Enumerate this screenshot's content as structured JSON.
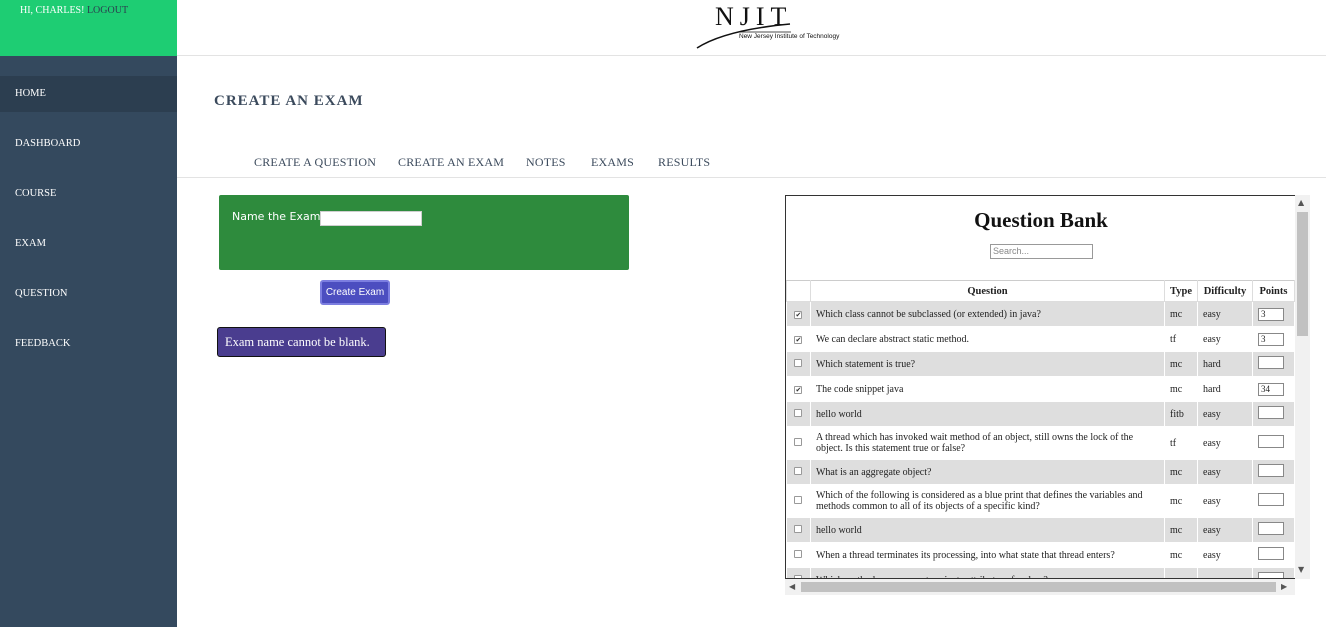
{
  "user": {
    "greeting": "HI, CHARLES!",
    "logout_label": "LOGOUT"
  },
  "sidebar": {
    "items": [
      {
        "label": "HOME",
        "active": true
      },
      {
        "label": "DASHBOARD"
      },
      {
        "label": "COURSE"
      },
      {
        "label": "EXAM"
      },
      {
        "label": "QUESTION"
      },
      {
        "label": "FEEDBACK"
      }
    ]
  },
  "header": {
    "logo_text": "NJIT",
    "logo_subtitle": "New Jersey Institute of Technology"
  },
  "page": {
    "title": "CREATE AN EXAM"
  },
  "subnav": {
    "items": [
      "CREATE A QUESTION",
      "CREATE AN EXAM",
      "NOTES",
      "EXAMS",
      "RESULTS"
    ]
  },
  "exam_form": {
    "name_label": "Name the Exam:",
    "name_value": "",
    "create_button": "Create Exam",
    "error_message": "Exam name cannot be blank."
  },
  "question_bank": {
    "title": "Question Bank",
    "search_placeholder": "Search...",
    "columns": [
      "",
      "Question",
      "Type",
      "Difficulty",
      "Points"
    ],
    "rows": [
      {
        "checked": true,
        "question": "Which class cannot be subclassed (or extended) in java?",
        "type": "mc",
        "difficulty": "easy",
        "points": "3"
      },
      {
        "checked": true,
        "question": "We can declare abstract static method.",
        "type": "tf",
        "difficulty": "easy",
        "points": "3"
      },
      {
        "checked": false,
        "question": "Which statement is true?",
        "type": "mc",
        "difficulty": "hard",
        "points": ""
      },
      {
        "checked": true,
        "question": "The code snippet java",
        "type": "mc",
        "difficulty": "hard",
        "points": "34"
      },
      {
        "checked": false,
        "question": "hello world",
        "type": "fitb",
        "difficulty": "easy",
        "points": ""
      },
      {
        "checked": false,
        "question": "A thread which has invoked wait method of an object, still owns the lock of the object. Is this statement true or false?",
        "type": "tf",
        "difficulty": "easy",
        "points": ""
      },
      {
        "checked": false,
        "question": "What is an aggregate object?",
        "type": "mc",
        "difficulty": "easy",
        "points": ""
      },
      {
        "checked": false,
        "question": "Which of the following is considered as a blue print that defines the variables and methods common to all of its objects of a specific kind?",
        "type": "mc",
        "difficulty": "easy",
        "points": ""
      },
      {
        "checked": false,
        "question": "hello world",
        "type": "mc",
        "difficulty": "easy",
        "points": ""
      },
      {
        "checked": false,
        "question": "When a thread terminates its processing, into what state that thread enters?",
        "type": "mc",
        "difficulty": "easy",
        "points": ""
      },
      {
        "checked": false,
        "question": "Which methods can access to private attributes of a class?",
        "type": "mc",
        "difficulty": "easy",
        "points": ""
      }
    ]
  },
  "colors": {
    "sidebar_bg": "#34495e",
    "greeting_bg": "#1ecd73",
    "exam_box_bg": "#2e8b3d",
    "button_bg": "#4c4ec0",
    "error_bg": "#4a3d8f"
  }
}
